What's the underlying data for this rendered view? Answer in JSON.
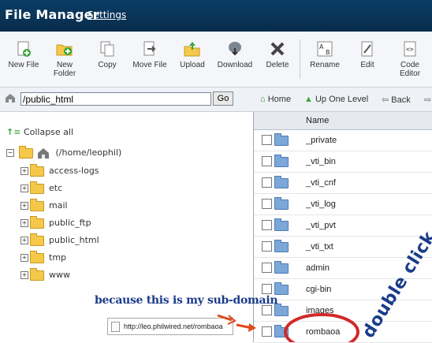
{
  "header": {
    "title": "File Manager",
    "settings_label": "Settings"
  },
  "toolbar": {
    "new_file": "New File",
    "new_folder_line1": "New",
    "new_folder_line2": "Folder",
    "copy": "Copy",
    "move_file": "Move File",
    "upload": "Upload",
    "download": "Download",
    "delete": "Delete",
    "rename": "Rename",
    "edit": "Edit",
    "code_editor_line1": "Code",
    "code_editor_line2": "Editor"
  },
  "pathbar": {
    "path_value": "/public_html",
    "go_label": "Go",
    "home_label": "Home",
    "up_one_level_label": "Up One Level",
    "back_label": "Back"
  },
  "tree": {
    "collapse_label": "Collapse all",
    "root_label": "(/home/leophil)",
    "items": [
      "access-logs",
      "etc",
      "mail",
      "public_ftp",
      "public_html",
      "tmp",
      "www"
    ]
  },
  "filelist": {
    "name_header": "Name",
    "rows": [
      "_private",
      "_vti_bin",
      "_vti_cnf",
      "_vti_log",
      "_vti_pvt",
      "_vti_txt",
      "admin",
      "cgi-bin",
      "images",
      "rombaoa"
    ]
  },
  "annotation": {
    "caption": "because this is my sub-domain",
    "url": "http://leo.philwired.net/rombaoa",
    "double_click": "double click"
  },
  "colors": {
    "title_bar": "#0b3d66",
    "annotation_text": "#1a3c8a",
    "circle": "#d12a2a",
    "arrow": "#e04a1a"
  }
}
